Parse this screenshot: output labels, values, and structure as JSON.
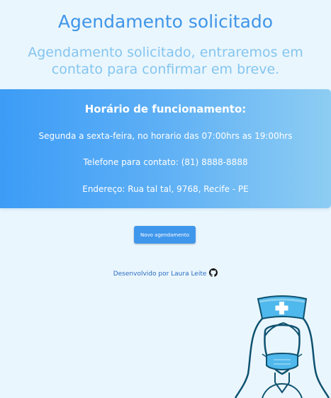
{
  "page": {
    "title": "Agendamento solicitado",
    "subtitle": "Agendamento solicitado, entraremos em contato para confirmar em breve."
  },
  "info_card": {
    "heading": "Horário de funcionamento:",
    "hours": "Segunda a sexta-feira, no horario das 07:00hrs as 19:00hrs",
    "phone": "Telefone para contato: (81) 8888-8888",
    "address": "Endereço: Rua tal tal, 9768, Recife - PE"
  },
  "actions": {
    "new_appointment_label": "Novo agendamento"
  },
  "footer": {
    "developed_by": "Desenvolvido por Laura Leite",
    "github_icon": "github-icon"
  },
  "illustration": {
    "icon": "nurse-illustration"
  },
  "colors": {
    "background": "#eaf6fd",
    "title": "#3f95e8",
    "subtitle": "#83c5ef",
    "card_gradient_start": "#3c9cf6",
    "card_gradient_end": "#8dcdf3",
    "button": "#3f97ec",
    "link": "#2a6cc0",
    "illustration_stroke": "#0e5270",
    "illustration_fill": "#4fb8ec"
  }
}
